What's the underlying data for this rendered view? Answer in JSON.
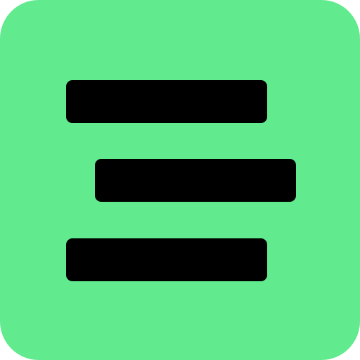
{
  "icon": {
    "name": "menu-lines-icon",
    "background_color": "#61EA8E",
    "bar_color": "#000000"
  }
}
